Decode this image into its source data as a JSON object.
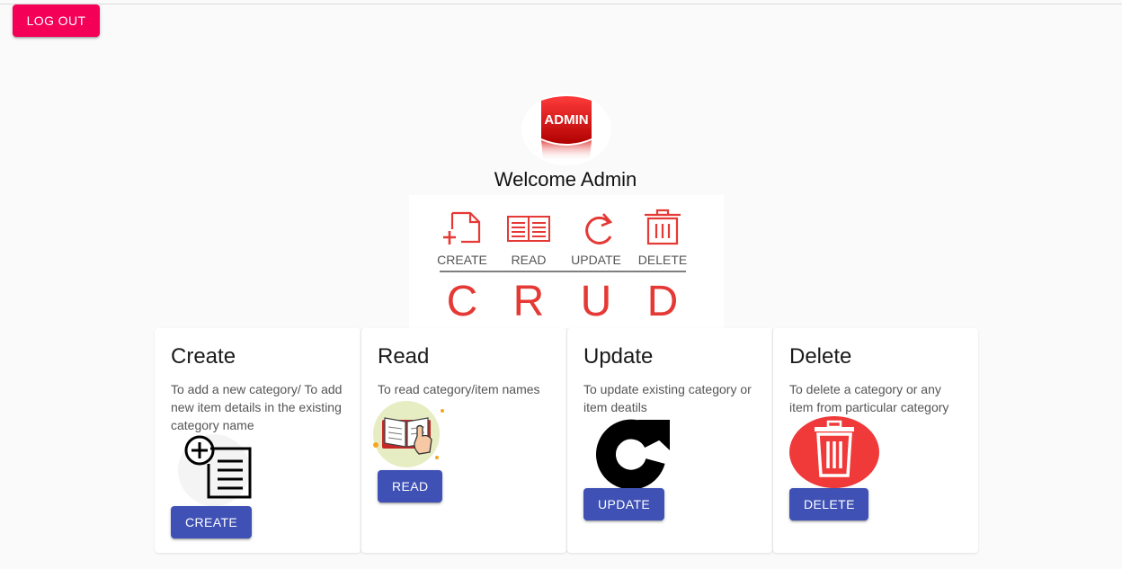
{
  "header": {
    "logout_label": "LOG OUT"
  },
  "welcome": {
    "avatar_text": "ADMIN",
    "text": "Welcome Admin"
  },
  "banner": {
    "ops": [
      "CREATE",
      "READ",
      "UPDATE",
      "DELETE"
    ],
    "letters": [
      "C",
      "R",
      "U",
      "D"
    ]
  },
  "cards": [
    {
      "title": "Create",
      "desc": "To add a new category/ To add new item details in the existing category name",
      "button": "CREATE",
      "icon": "add-list-icon"
    },
    {
      "title": "Read",
      "desc": "To read category/item names",
      "button": "READ",
      "icon": "book-hand-icon"
    },
    {
      "title": "Update",
      "desc": "To update existing category or item deatils",
      "button": "UPDATE",
      "icon": "refresh-icon"
    },
    {
      "title": "Delete",
      "desc": "To delete a category or any item from particular category",
      "button": "DELETE",
      "icon": "trash-icon"
    }
  ],
  "colors": {
    "logout": "#f50057",
    "primary": "#3f51b5",
    "crud_red": "#e53935"
  }
}
